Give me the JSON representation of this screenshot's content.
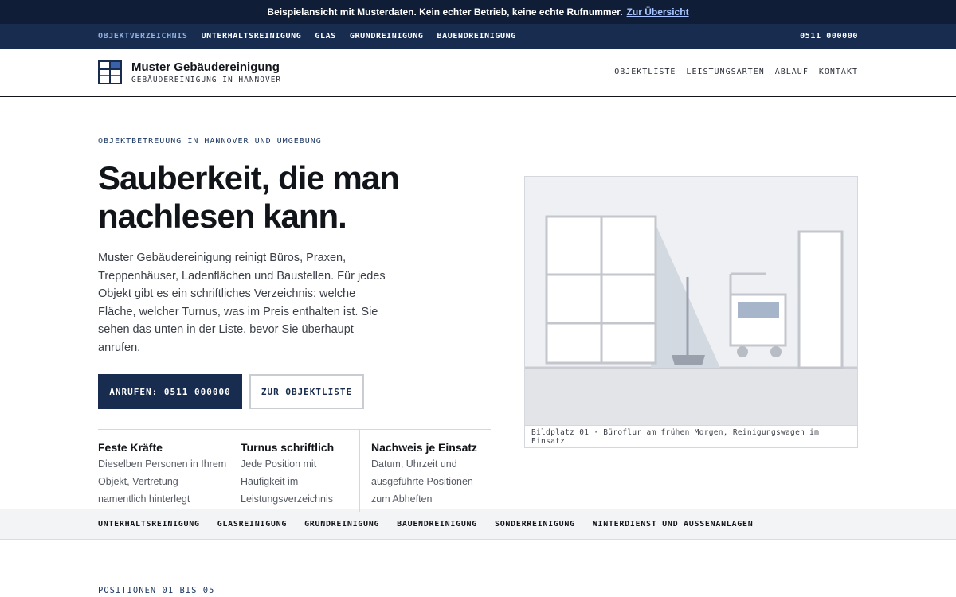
{
  "demo_banner": {
    "text": "Beispielansicht mit Musterdaten. Kein echter Betrieb, keine echte Rufnummer.",
    "link": "Zur Übersicht"
  },
  "topnav": {
    "items": [
      "OBJEKTVERZEICHNIS",
      "UNTERHALTSREINIGUNG",
      "GLAS",
      "GRUNDREINIGUNG",
      "BAUENDREINIGUNG"
    ],
    "phone": "0511 000000"
  },
  "header": {
    "brand_name": "Muster Gebäudereinigung",
    "brand_sub": "GEBÄUDEREINIGUNG IN HANNOVER",
    "nav": [
      "OBJEKTLISTE",
      "LEISTUNGSARTEN",
      "ABLAUF",
      "KONTAKT"
    ]
  },
  "hero": {
    "eyebrow": "OBJEKTBETREUUNG IN HANNOVER UND UMGEBUNG",
    "title_line1": "Sauberkeit, die man",
    "title_line2": "nachlesen kann.",
    "lead": "Muster Gebäudereinigung reinigt Büros, Praxen, Treppenhäuser, Ladenflächen und Baustellen. Für jedes Objekt gibt es ein schriftliches Verzeichnis: welche Fläche, welcher Turnus, was im Preis enthalten ist. Sie sehen das unten in der Liste, bevor Sie überhaupt anrufen.",
    "cta_primary": "ANRUFEN: 0511 000000",
    "cta_secondary": "ZUR OBJEKTLISTE",
    "features": [
      {
        "title": "Feste Kräfte",
        "text": "Dieselben Personen in Ihrem Objekt, Vertretung namentlich hinterlegt"
      },
      {
        "title": "Turnus schriftlich",
        "text": "Jede Position mit Häufigkeit im Leistungsverzeichnis"
      },
      {
        "title": "Nachweis je Einsatz",
        "text": "Datum, Uhrzeit und ausgeführte Positionen zum Abheften"
      }
    ],
    "figure_caption": "Bildplatz 01 · Büroflur am frühen Morgen, Reinigungswagen im Einsatz"
  },
  "services_strip": [
    "UNTERHALTSREINIGUNG",
    "GLASREINIGUNG",
    "GRUNDREINIGUNG",
    "BAUENDREINIGUNG",
    "SONDERREINIGUNG",
    "WINTERDIENST UND AUSSENANLAGEN"
  ],
  "positions_label": "POSITIONEN 01 BIS 05",
  "colors": {
    "navy": "#182c4f",
    "banner": "#0f1d36",
    "accent_link": "#a9c4ff"
  }
}
